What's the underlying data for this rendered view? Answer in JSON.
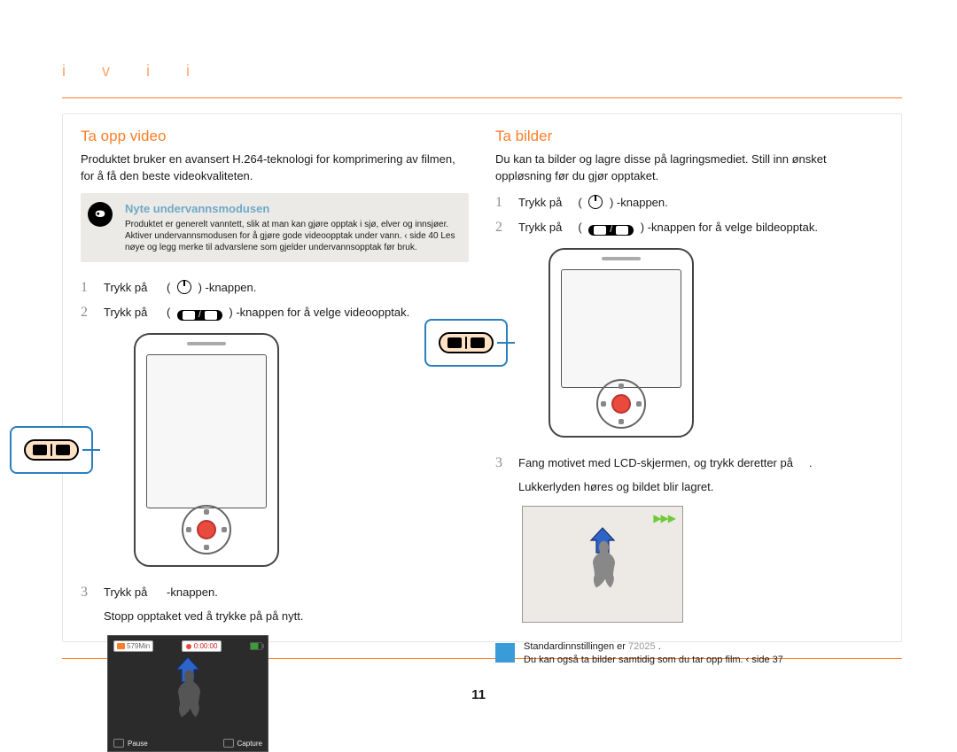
{
  "chapter_dots": "i       v   i       i",
  "left": {
    "title": "Ta opp video",
    "intro": "Produktet bruker en avansert H.264-teknologi for komprimering av filmen, for å få den beste videokvaliteten.",
    "under": {
      "title": "Nyte undervannsmodusen",
      "text": "Produktet er generelt vanntett, slik at man kan gjøre opptak i sjø, elver og innsjøer. Aktiver undervannsmodusen for å gjøre gode videoopptak under vann. ‹ side 40 Les nøye og legg merke til advarslene som gjelder undervannsopptak før bruk."
    },
    "steps": [
      {
        "pre": "Trykk på",
        "post": "-knappen.",
        "icon": "power",
        "n": "1"
      },
      {
        "pre": "Trykk på",
        "post": "-knappen for å velge videoopptak.",
        "icon": "mode",
        "n": "2"
      },
      {
        "pre": "Trykk på",
        "post": "-knappen.",
        "icon": "none",
        "n": "3"
      }
    ],
    "step3_sub": "Stopp opptaket ved å trykke på        på nytt.",
    "lcd": {
      "min": "579Min",
      "time": "0:00:00",
      "pause": "Pause",
      "capture": "Capture"
    }
  },
  "right": {
    "title": "Ta bilder",
    "intro": "Du kan ta bilder og lagre disse på lagringsmediet. Still inn ønsket oppløsning før du gjør opptaket.",
    "steps": [
      {
        "pre": "Trykk på",
        "post": "-knappen.",
        "icon": "power",
        "n": "1"
      },
      {
        "pre": "Trykk på",
        "post": "-knappen for å velge bildeopptak.",
        "icon": "mode",
        "n": "2"
      },
      {
        "pre": "Fang motivet med LCD-skjermen, og trykk deretter på",
        "post": ".",
        "icon": "none",
        "n": "3"
      }
    ],
    "step3_sub": "Lukkerlyden høres og bildet blir lagret.",
    "info": {
      "line1_a": "Standardinnstillingen er ",
      "line1_b": "72025",
      "line1_c": " .",
      "line2": "Du kan også ta bilder samtidig som du tar opp film. ‹ side 37"
    }
  },
  "icons": {
    "scuba": "scuba-diver-icon",
    "power": "power-icon",
    "mode": "mode-switch-icon",
    "arrow": "blue-arrow-icon",
    "ffwd": "fast-forward-icon"
  },
  "page_number": "11"
}
